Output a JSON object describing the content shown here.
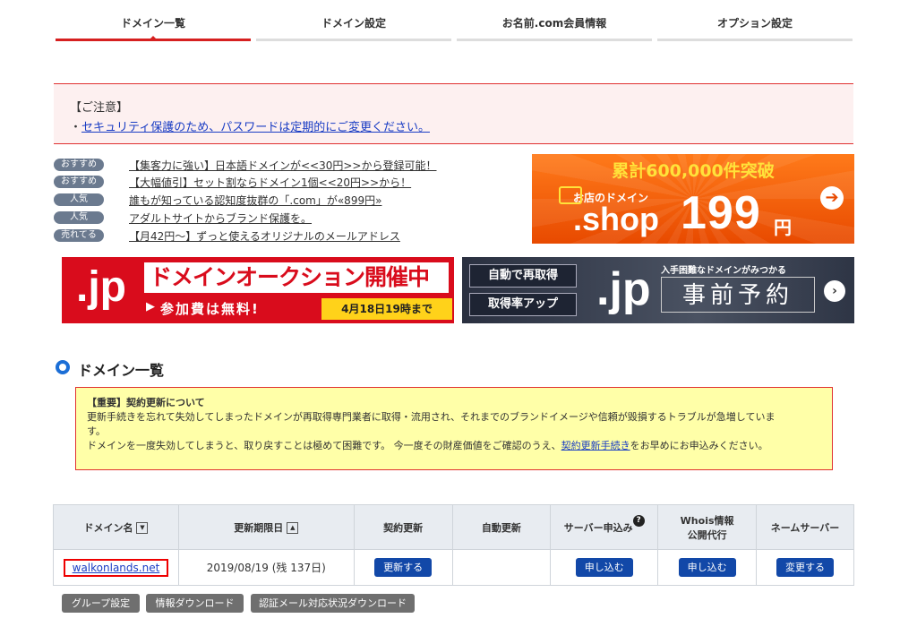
{
  "tabs": [
    {
      "label": "ドメイン一覧"
    },
    {
      "label": "ドメイン設定"
    },
    {
      "label": "お名前.com会員情報"
    },
    {
      "label": "オプション設定"
    }
  ],
  "notice": {
    "title": "【ご注意】",
    "bullet": "・",
    "link": "セキュリティ保護のため、パスワードは定期的にご変更ください。"
  },
  "recommendations": [
    {
      "badge": "おすすめ",
      "text": "【集客力に強い】日本語ドメインが<<30円>>から登録可能！"
    },
    {
      "badge": "おすすめ",
      "text": "【大幅値引】セット割ならドメイン1個<<20円>>から！"
    },
    {
      "badge": "人気",
      "text": "誰もが知っている認知度抜群の「.com」が«899円»"
    },
    {
      "badge": "人気",
      "text": "アダルトサイトからブランド保護を。"
    },
    {
      "badge": "売れてる",
      "text": "【月42円〜】ずっと使えるオリジナルのメールアドレス"
    }
  ],
  "banner_shop": {
    "line1": "累計600,000件突破",
    "line2": "お店のドメイン",
    "domain": ".shop",
    "price": "199",
    "unit": "円"
  },
  "banner_auction": {
    "domain": ".jp",
    "title": "ドメインオークション開催中",
    "sub": "参加費は無料!",
    "date": "4月18日19時まで"
  },
  "banner_reserve": {
    "tag1": "自動で再取得",
    "tag2": "取得率アップ",
    "domain": ".jp",
    "small": "入手困難なドメインがみつかる",
    "big": "事前予約"
  },
  "section": {
    "title": "ドメイン一覧"
  },
  "important": {
    "heading": "【重要】契約更新について",
    "line1": "更新手続きを忘れて失効してしまったドメインが再取得専門業者に取得・流用され、それまでのブランドイメージや信頼が毀損するトラブルが急増していま",
    "line2": "す。",
    "line3_pre": "ドメインを一度失効してしまうと、取り戻すことは極めて困難です。 今一度その財産価値をご確認のうえ、",
    "line3_link": "契約更新手続き",
    "line3_post": "をお早めにお申込みください。"
  },
  "table": {
    "headers": {
      "domain": "ドメイン名",
      "sort_down": "▼",
      "expiry": "更新期限日",
      "sort_up": "▲",
      "renew": "契約更新",
      "auto": "自動更新",
      "server": "サーバー申込み",
      "help": "?",
      "whois1": "Whois情報",
      "whois2": "公開代行",
      "ns": "ネームサーバー"
    },
    "row": {
      "domain": "walkonlands.net",
      "expiry": "2019/08/19 (残 137日)",
      "renew_btn": "更新する",
      "auto": "",
      "server_btn": "申し込む",
      "whois_btn": "申し込む",
      "ns_btn": "変更する"
    }
  },
  "bottom_buttons": {
    "group": "グループ設定",
    "download": "情報ダウンロード",
    "auth_mail": "認証メール対応状況ダウンロード"
  },
  "colors": {
    "accent_red": "#d62020",
    "link_blue": "#1a3dc4",
    "button_blue": "#1248a8",
    "badge_gray": "#6b7a8f",
    "shop_orange": "#f05a0a"
  }
}
